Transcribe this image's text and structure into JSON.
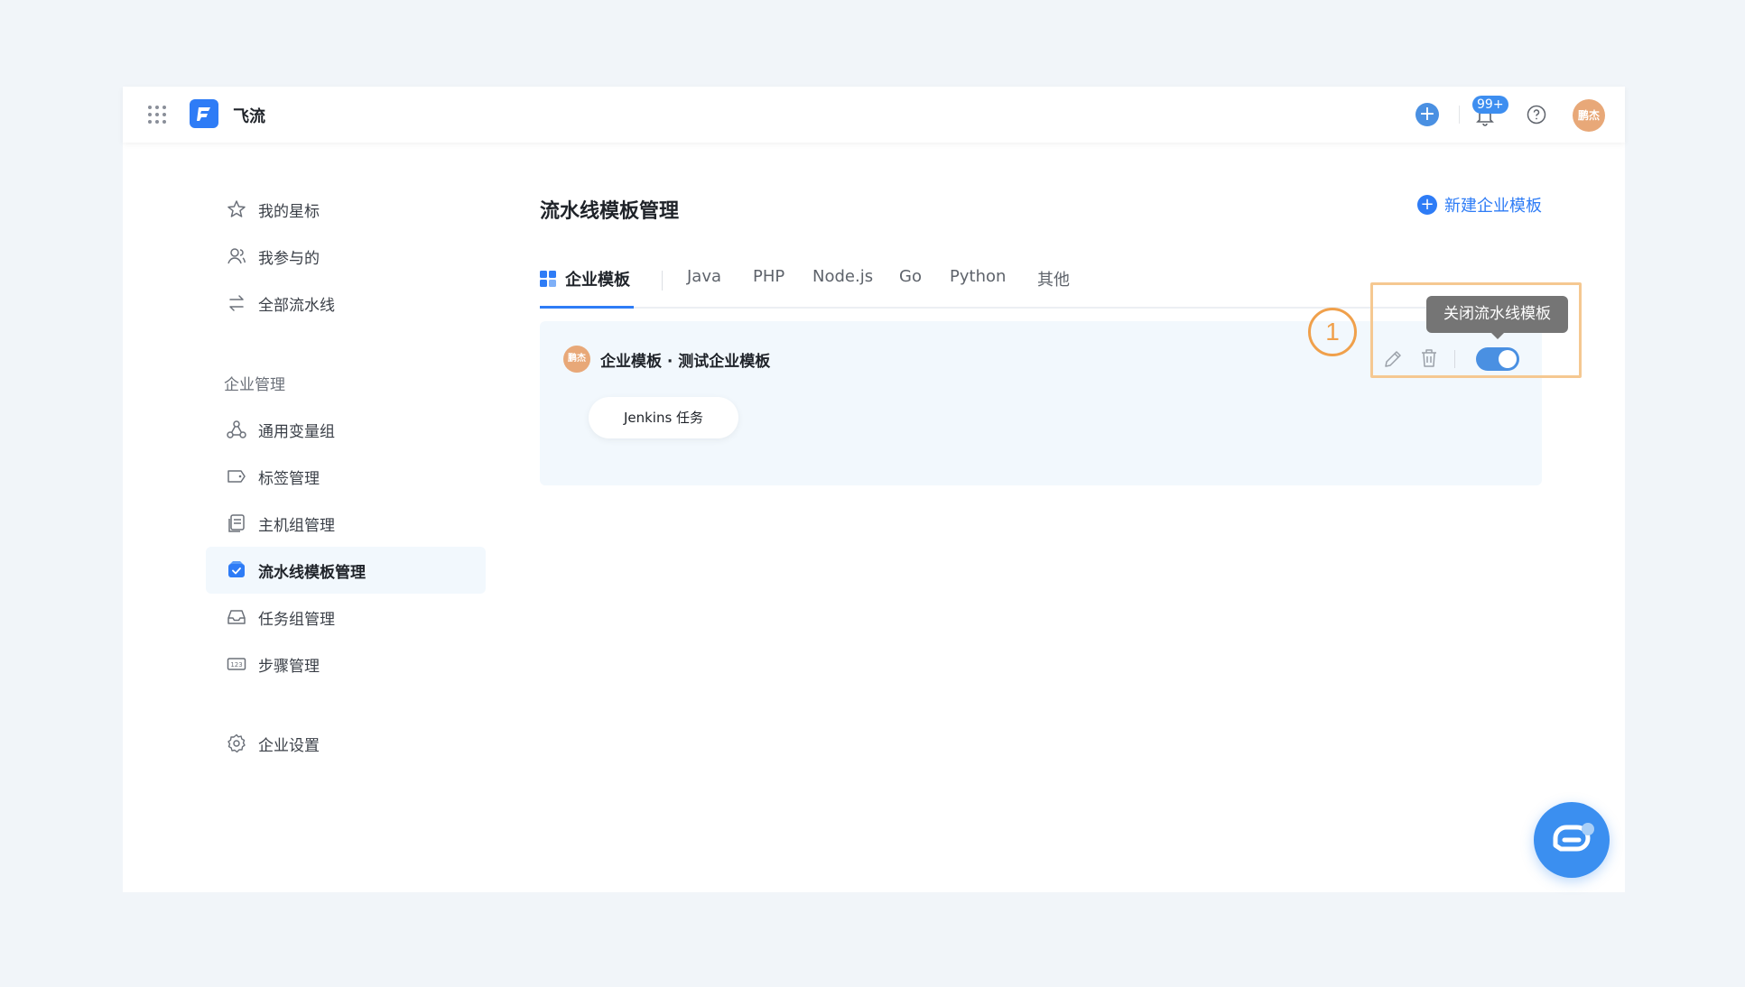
{
  "topbar": {
    "app_name": "飞流",
    "notification_badge": "99+",
    "user_avatar_text": "鹏杰"
  },
  "sidebar": {
    "items_top": [
      {
        "label": "我的星标",
        "icon": "star-icon"
      },
      {
        "label": "我参与的",
        "icon": "user-icon"
      },
      {
        "label": "全部流水线",
        "icon": "swap-icon"
      }
    ],
    "group_label": "企业管理",
    "items_group": [
      {
        "label": "通用变量组",
        "icon": "nodes-icon"
      },
      {
        "label": "标签管理",
        "icon": "tag-icon"
      },
      {
        "label": "主机组管理",
        "icon": "host-icon"
      },
      {
        "label": "流水线模板管理",
        "icon": "template-icon",
        "active": true
      },
      {
        "label": "任务组管理",
        "icon": "inbox-icon"
      },
      {
        "label": "步骤管理",
        "icon": "steps-icon"
      }
    ],
    "settings_label": "企业设置"
  },
  "main": {
    "title": "流水线模板管理",
    "new_button_label": "新建企业模板",
    "tabs": [
      {
        "label": "企业模板",
        "active": true
      },
      {
        "label": "Java"
      },
      {
        "label": "PHP"
      },
      {
        "label": "Node.js"
      },
      {
        "label": "Go"
      },
      {
        "label": "Python"
      },
      {
        "label": "其他"
      }
    ],
    "card": {
      "avatar_text": "鹏杰",
      "title": "企业模板 · 测试企业模板",
      "chip_label": "Jenkins 任务"
    },
    "tooltip": "关闭流水线模板",
    "step_marker": "1"
  },
  "colors": {
    "accent": "#2e7cf6",
    "highlight": "#f5c891",
    "marker": "#f0a04b"
  }
}
